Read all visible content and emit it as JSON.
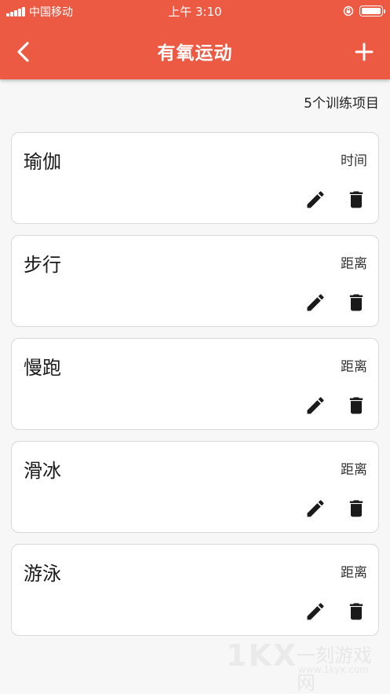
{
  "status_bar": {
    "carrier": "中国移动",
    "time": "上午 3:10"
  },
  "header": {
    "title": "有氧运动",
    "back_icon": "chevron-left-icon",
    "add_icon": "plus-icon",
    "color": "#ec5a43"
  },
  "summary": {
    "count_text": "5个训练项目"
  },
  "items": [
    {
      "name": "瑜伽",
      "type": "时间"
    },
    {
      "name": "步行",
      "type": "距离"
    },
    {
      "name": "慢跑",
      "type": "距离"
    },
    {
      "name": "滑冰",
      "type": "距离"
    },
    {
      "name": "游泳",
      "type": "距离"
    }
  ],
  "actions": {
    "edit_icon": "pencil-icon",
    "delete_icon": "trash-icon"
  },
  "watermark": {
    "logo": "1KX",
    "name": "一刻游戏网",
    "url": "www.1kyx.com"
  }
}
